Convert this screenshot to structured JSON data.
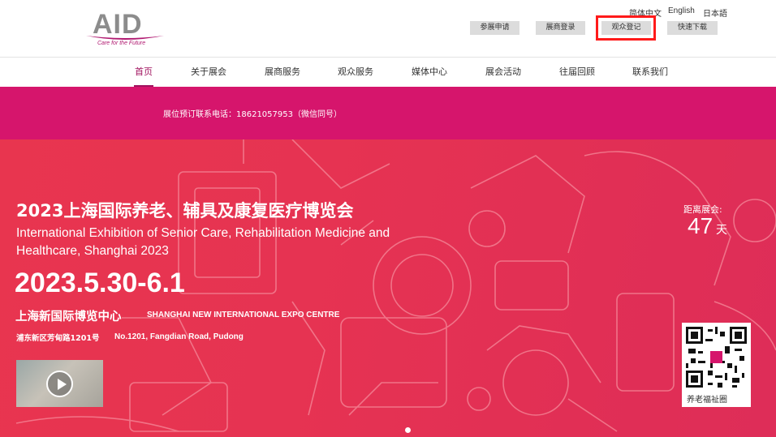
{
  "logo": {
    "text": "AID",
    "tagline": "Care for the Future"
  },
  "languages": [
    "简体中文",
    "English",
    "日本語"
  ],
  "top_buttons": [
    "参展申请",
    "展商登录",
    "观众登记",
    "快速下载"
  ],
  "nav": {
    "items": [
      "首页",
      "关于展会",
      "展商服务",
      "观众服务",
      "媒体中心",
      "展会活动",
      "往届回顾",
      "联系我们"
    ],
    "active": "首页"
  },
  "banner": {
    "phone_text": "展位预订联系电话：18621057953（微信同号）"
  },
  "hero": {
    "title_cn": "2023上海国际养老、辅具及康复医疗博览会",
    "title_en": "International Exhibition of Senior Care, Rehabilitation Medicine and Healthcare, Shanghai 2023",
    "dates": "2023.5.30-6.1",
    "venue_cn": "上海新国际博览中心",
    "venue_en": "SHANGHAI NEW INTERNATIONAL EXPO CENTRE",
    "address_cn": "浦东新区芳甸路1201号",
    "address_en": "No.1201, Fangdian Road, Pudong"
  },
  "countdown": {
    "label": "距离展会:",
    "days": "47",
    "unit": "天"
  },
  "qr": {
    "caption": "养老福祉圈"
  },
  "colors": {
    "brand": "#a0125e",
    "banner": "#d6156c",
    "hero": "#e63352",
    "highlight": "#ff1a1a"
  }
}
